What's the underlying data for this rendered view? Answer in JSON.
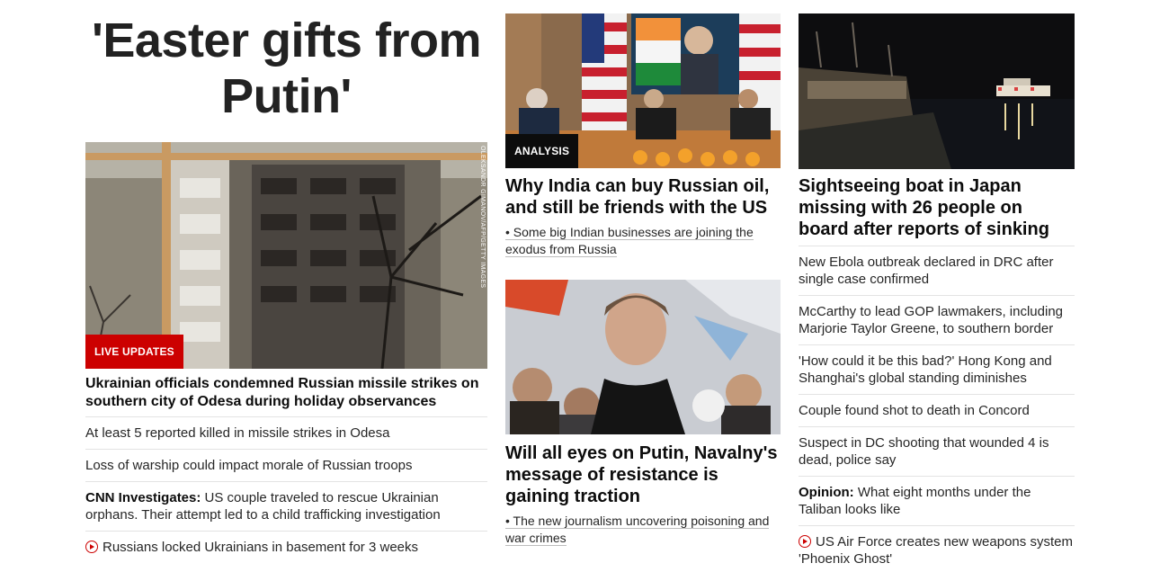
{
  "col1": {
    "headline_line1": "'Easter gifts from",
    "headline_line2": "Putin'",
    "badge": "LIVE UPDATES",
    "credit": "OLEKSANDR GIMANOV/AFP/GETTY IMAGES",
    "lead_title": "Ukrainian officials condemned Russian missile strikes on southern city of Odesa during holiday observances",
    "links": [
      {
        "text": "At least 5 reported killed in missile strikes in Odesa"
      },
      {
        "text": "Loss of warship could impact morale of Russian troops"
      },
      {
        "prefix": "CNN Investigates:",
        "text": " US couple traveled to rescue Ukrainian orphans. Their attempt led to a child trafficking investigation"
      },
      {
        "text": "Russians locked Ukrainians in basement for 3 weeks"
      }
    ]
  },
  "col2": {
    "card1": {
      "badge": "ANALYSIS",
      "title": "Why India can buy Russian oil, and still be friends with the US",
      "sub": "• Some big Indian businesses are joining the exodus from Russia"
    },
    "card2": {
      "title": "Will all eyes on Putin, Navalny's message of resistance is gaining traction",
      "sub": "• The new journalism uncovering poisoning and war crimes"
    }
  },
  "col3": {
    "title": "Sightseeing boat in Japan missing with 26 people on board after reports of sinking",
    "links": [
      {
        "text": "New Ebola outbreak declared in DRC after single case confirmed"
      },
      {
        "text": "McCarthy to lead GOP lawmakers, including Marjorie Taylor Greene, to southern border"
      },
      {
        "text": "'How could it be this bad?' Hong Kong and Shanghai's global standing diminishes"
      },
      {
        "text": "Couple found shot to death in Concord"
      },
      {
        "text": "Suspect in DC shooting that wounded 4 is dead, police say"
      },
      {
        "prefix": "Opinion:",
        "text": " What eight months under the Taliban looks like"
      },
      {
        "text": "US Air Force creates new weapons system 'Phoenix Ghost'"
      }
    ]
  },
  "colors": {
    "live": "#cc0000",
    "analysis": "#0c0c0c",
    "divider": "#e3e3e3"
  },
  "icons": {
    "video": "play-circle-icon"
  }
}
